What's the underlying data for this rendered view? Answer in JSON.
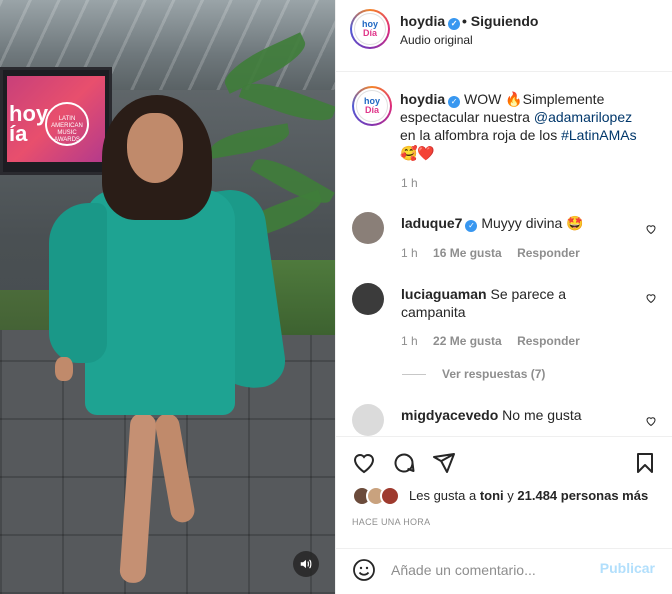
{
  "media": {
    "screen_text": "hoy\nía",
    "screen_logo_text": "LATIN AMERICAN MUSIC AWARDS"
  },
  "header": {
    "username": "hoydia",
    "follow_text": "• Siguiendo",
    "audio": "Audio original",
    "avatar_top": "hoy",
    "avatar_bottom": "Día"
  },
  "caption": {
    "username": "hoydia",
    "text_before": " WOW 🔥Simplemente espectacular nuestra ",
    "mention": "@adamarilopez",
    "text_middle": " en la alfombra roja de los ",
    "hashtag": "#LatinAMAs",
    "text_after": " 🥰❤️",
    "time": "1 h"
  },
  "comments": [
    {
      "username": "laduque7",
      "verified": true,
      "text": "Muyyy divina 🤩",
      "time": "1 h",
      "likes": "16 Me gusta",
      "reply": "Responder",
      "avatar_color": "#8a7f78"
    },
    {
      "username": "luciaguaman",
      "verified": false,
      "text": "Se parece a campanita",
      "time": "1 h",
      "likes": "22 Me gusta",
      "reply": "Responder",
      "avatar_color": "#3b3b3b"
    },
    {
      "username": "migdyacevedo",
      "verified": false,
      "text": "No me gusta",
      "avatar_color": "#dbdbdb"
    }
  ],
  "view_replies": "Ver respuestas (7)",
  "likes": {
    "prefix": "Les gusta a ",
    "first": "toni",
    "middle": " y ",
    "count": "21.484 personas más"
  },
  "timestamp": "HACE UNA HORA",
  "add_comment": {
    "placeholder": "Añade un comentario...",
    "publish": "Publicar"
  },
  "colors": {
    "link": "#00376b",
    "verified": "#3897f0",
    "muted": "#8e8e8e",
    "publish_disabled": "#b2dffc"
  }
}
